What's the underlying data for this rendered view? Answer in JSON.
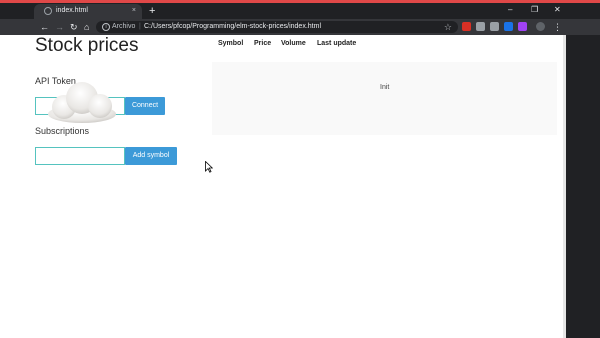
{
  "browser": {
    "tab_title": "index.html",
    "tab_close": "×",
    "new_tab": "+",
    "window_controls": {
      "minimize": "–",
      "restore": "❐",
      "close": "✕"
    },
    "nav": {
      "back": "←",
      "forward": "→",
      "reload": "↻",
      "home": "⌂"
    },
    "address": {
      "info_icon": "i",
      "scheme_label": "Archivo",
      "separator": "|",
      "url": "C:/Users/pfcop/Programming/elm-stock-prices/index.html",
      "bookmark_star": "☆"
    },
    "extension_colors": [
      "#d93025",
      "#9aa0a6",
      "#9aa0a6",
      "#1a73e8",
      "#a142f4"
    ],
    "menu": "⋮",
    "accent_color": "#e04848"
  },
  "page": {
    "title": "Stock prices",
    "api_token": {
      "label": "API Token",
      "value": "",
      "connect_label": "Connect"
    },
    "subscriptions": {
      "label": "Subscriptions",
      "value": "",
      "add_label": "Add symbol"
    },
    "table": {
      "columns": [
        "Symbol",
        "Price",
        "Volume",
        "Last update"
      ],
      "status": "Init"
    },
    "button_color": "#3c9ad8",
    "input_border_color": "#55c3bf"
  }
}
